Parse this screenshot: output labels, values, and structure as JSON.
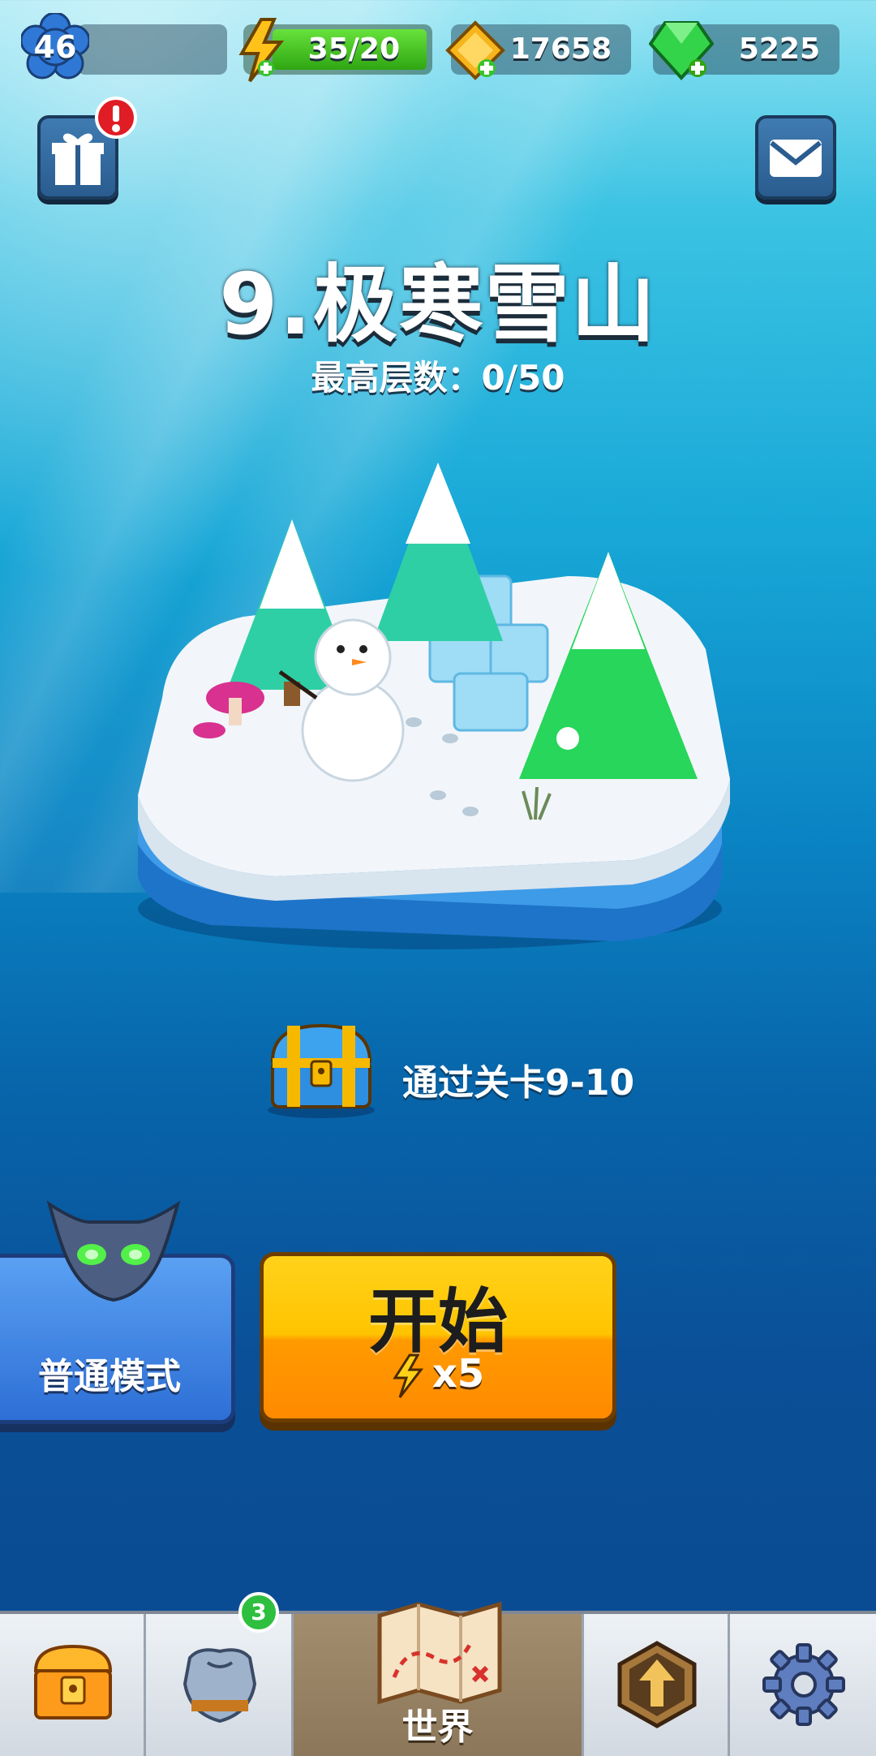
{
  "topbar": {
    "level": "46",
    "energy": "35/20",
    "gold": "17658",
    "gems": "5225"
  },
  "stage": {
    "title": "9.极寒雪山",
    "subtitle": "最高层数：0/50"
  },
  "reward": {
    "text": "通过关卡9-10"
  },
  "mode_button": {
    "label": "普通模式"
  },
  "start_button": {
    "label": "开始",
    "cost": "x5"
  },
  "bottom_nav": {
    "world_label": "世界",
    "equipment_badge": "3"
  },
  "colors": {
    "energy_bar": "#3bbd1f",
    "start_button": "#ffc400",
    "mode_button": "#2d6fd6",
    "nav_active": "#8c775a"
  },
  "icons": {
    "level": "blue-flower-badge-icon",
    "energy": "lightning-icon",
    "gold": "gold-ticket-icon",
    "gems": "green-gem-icon",
    "gift": "gift-icon",
    "mail": "mail-icon",
    "chest_reward": "treasure-chest-icon",
    "mode": "demon-mask-icon",
    "nav_shop": "shop-chest-icon",
    "nav_equipment": "armor-icon",
    "nav_world": "map-icon",
    "nav_upgrade": "upgrade-arrow-icon",
    "nav_settings": "gear-icon"
  }
}
